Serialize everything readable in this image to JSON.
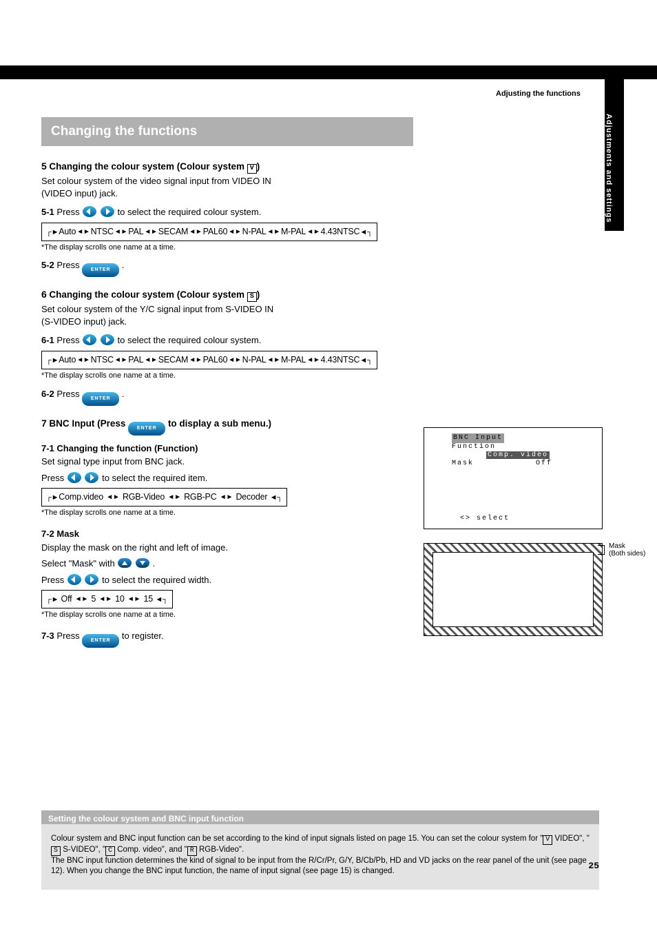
{
  "sideTab": "Adjustments and settings",
  "cornerTitle": "Adjusting the functions",
  "sectionBar": "Changing the functions",
  "steps": {
    "s5": {
      "num": "5",
      "title": "Changing the colour system (Colour system ",
      "title_after": ")",
      "line1": "Set colour system of the video signal input from ",
      "label": "VIDEO IN<br>(VIDEO input) jack.",
      "subnum": "5-1",
      "press_text": "Press           to select the required colour system.",
      "flow": "Auto↔NTSC↔PAL↔SECAM↔PAL60↔N-PAL↔M-PAL↔4.43NTSC",
      "note": "*The display scrolls one name at a time.",
      "subnum2": "5-2",
      "press_enter": "Press         ."
    },
    "s6": {
      "num": "6",
      "title": "Changing the colour system (Colour system ",
      "title_after": ")",
      "line1": "Set colour system of the Y/C signal input from ",
      "label": "  S-VIDEO IN<br>(S-VIDEO input) jack.",
      "subnum": "6-1",
      "press_text": "Press           to select the required colour system.",
      "flow": "Auto↔NTSC↔PAL↔SECAM↔PAL60↔N-PAL↔M-PAL↔4.43NTSC",
      "note": "*The display scrolls one name at a time.",
      "subnum2": "6-2",
      "press_enter": "Press         ."
    },
    "s7": {
      "num": "7",
      "title": " BNC Input (Press          to display a sub menu.)",
      "f_num": "7-1",
      "f_title": " Changing the function (Function)",
      "f_line1": "Set signal type input from BNC jack.",
      "f_sub": "Press           to select the required item.",
      "f_flow": "Comp.video ↔ RGB-Video ↔ RGB-PC ↔ Decoder",
      "f_note": "*The display scrolls one name at a time.",
      "m_num": "7-2",
      "m_title": "  Mask",
      "m_line1": "Display the mask on the right and left of image.",
      "m_line2": "Select ",
      "m_sub_a": "Select \"Mask\" with         .",
      "m_sub_b": "Press           to select the required width.",
      "m_flow": "Off ↔ 5 ↔ 10 ↔ 15",
      "m_note": "*The display scrolls one name at a time.",
      "p_num": "7-3",
      "p_text": "Press          to register."
    }
  },
  "osd": {
    "title": "BNC Input",
    "row1a": "Function",
    "row1b": "Comp. video",
    "row2a": "Mask",
    "row2b": "Off",
    "footer": "<> select"
  },
  "maskLabel": "Mask\n(Both sides)",
  "footer": {
    "title": "Setting the colour system and BNC input function",
    "text": "Colour system and BNC input function can be set according to the kind of input signals listed on page 15.  You can set the colour system for \"      VIDEO\", \"      S-VIDEO\", \"      Comp. video\", and \"      RGB-Video\".\nThe BNC input function determines the kind of signal to be input from the R/Cr/Pr, G/Y, B/Cb/Pb, HD and VD jacks on the rear panel of the unit (see page 12). When you change the BNC input function, the name of input signal (see page 15) is changed.",
    "badge_v": "V",
    "badge_s": "S",
    "badge_c": "C",
    "badge_r": "R"
  },
  "pageNum": "25"
}
